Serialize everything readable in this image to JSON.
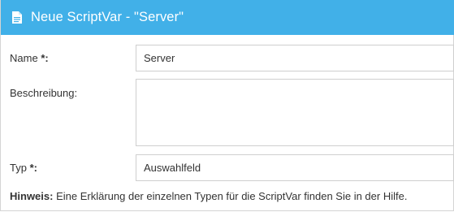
{
  "dialog": {
    "title": "Neue ScriptVar - \"Server\"",
    "title_icon": "document-icon",
    "header_color": "#41b0e8"
  },
  "form": {
    "name_label": "Name",
    "name_required": "*:",
    "name_value": "Server",
    "description_label": "Beschreibung:",
    "description_value": "",
    "type_label": "Typ",
    "type_required": "*:",
    "type_value": "Auswahlfeld"
  },
  "hint": {
    "label": "Hinweis:",
    "text": " Eine Erklärung der einzelnen Typen für die ScriptVar finden Sie in der Hilfe."
  }
}
